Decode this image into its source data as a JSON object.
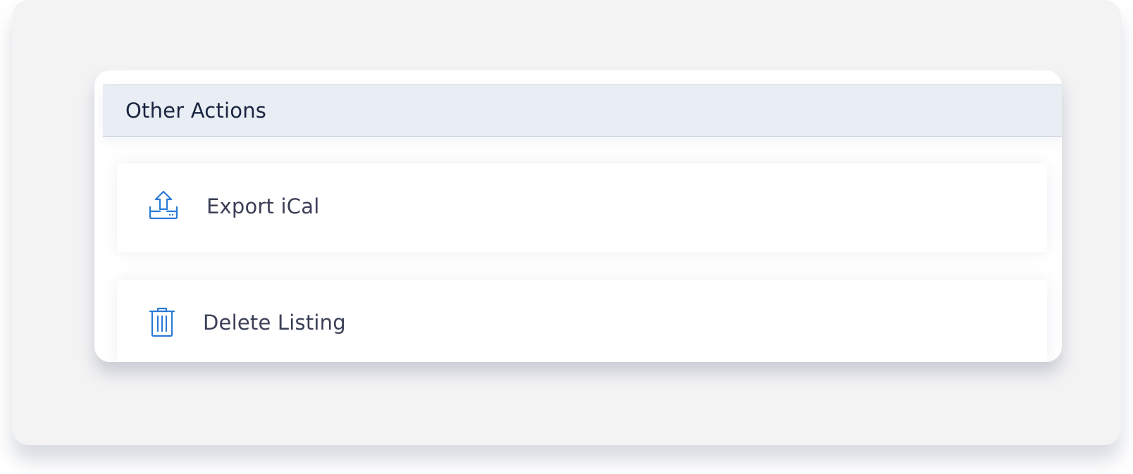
{
  "panel": {
    "title": "Other Actions",
    "actions": [
      {
        "label": "Export iCal",
        "icon": "export-upload-icon"
      },
      {
        "label": "Delete Listing",
        "icon": "trash-icon"
      }
    ]
  },
  "colors": {
    "icon_accent": "#2a7bd6",
    "header_background": "#e9eef5",
    "label_text": "#3b3f56",
    "title_text": "#1a2540"
  }
}
